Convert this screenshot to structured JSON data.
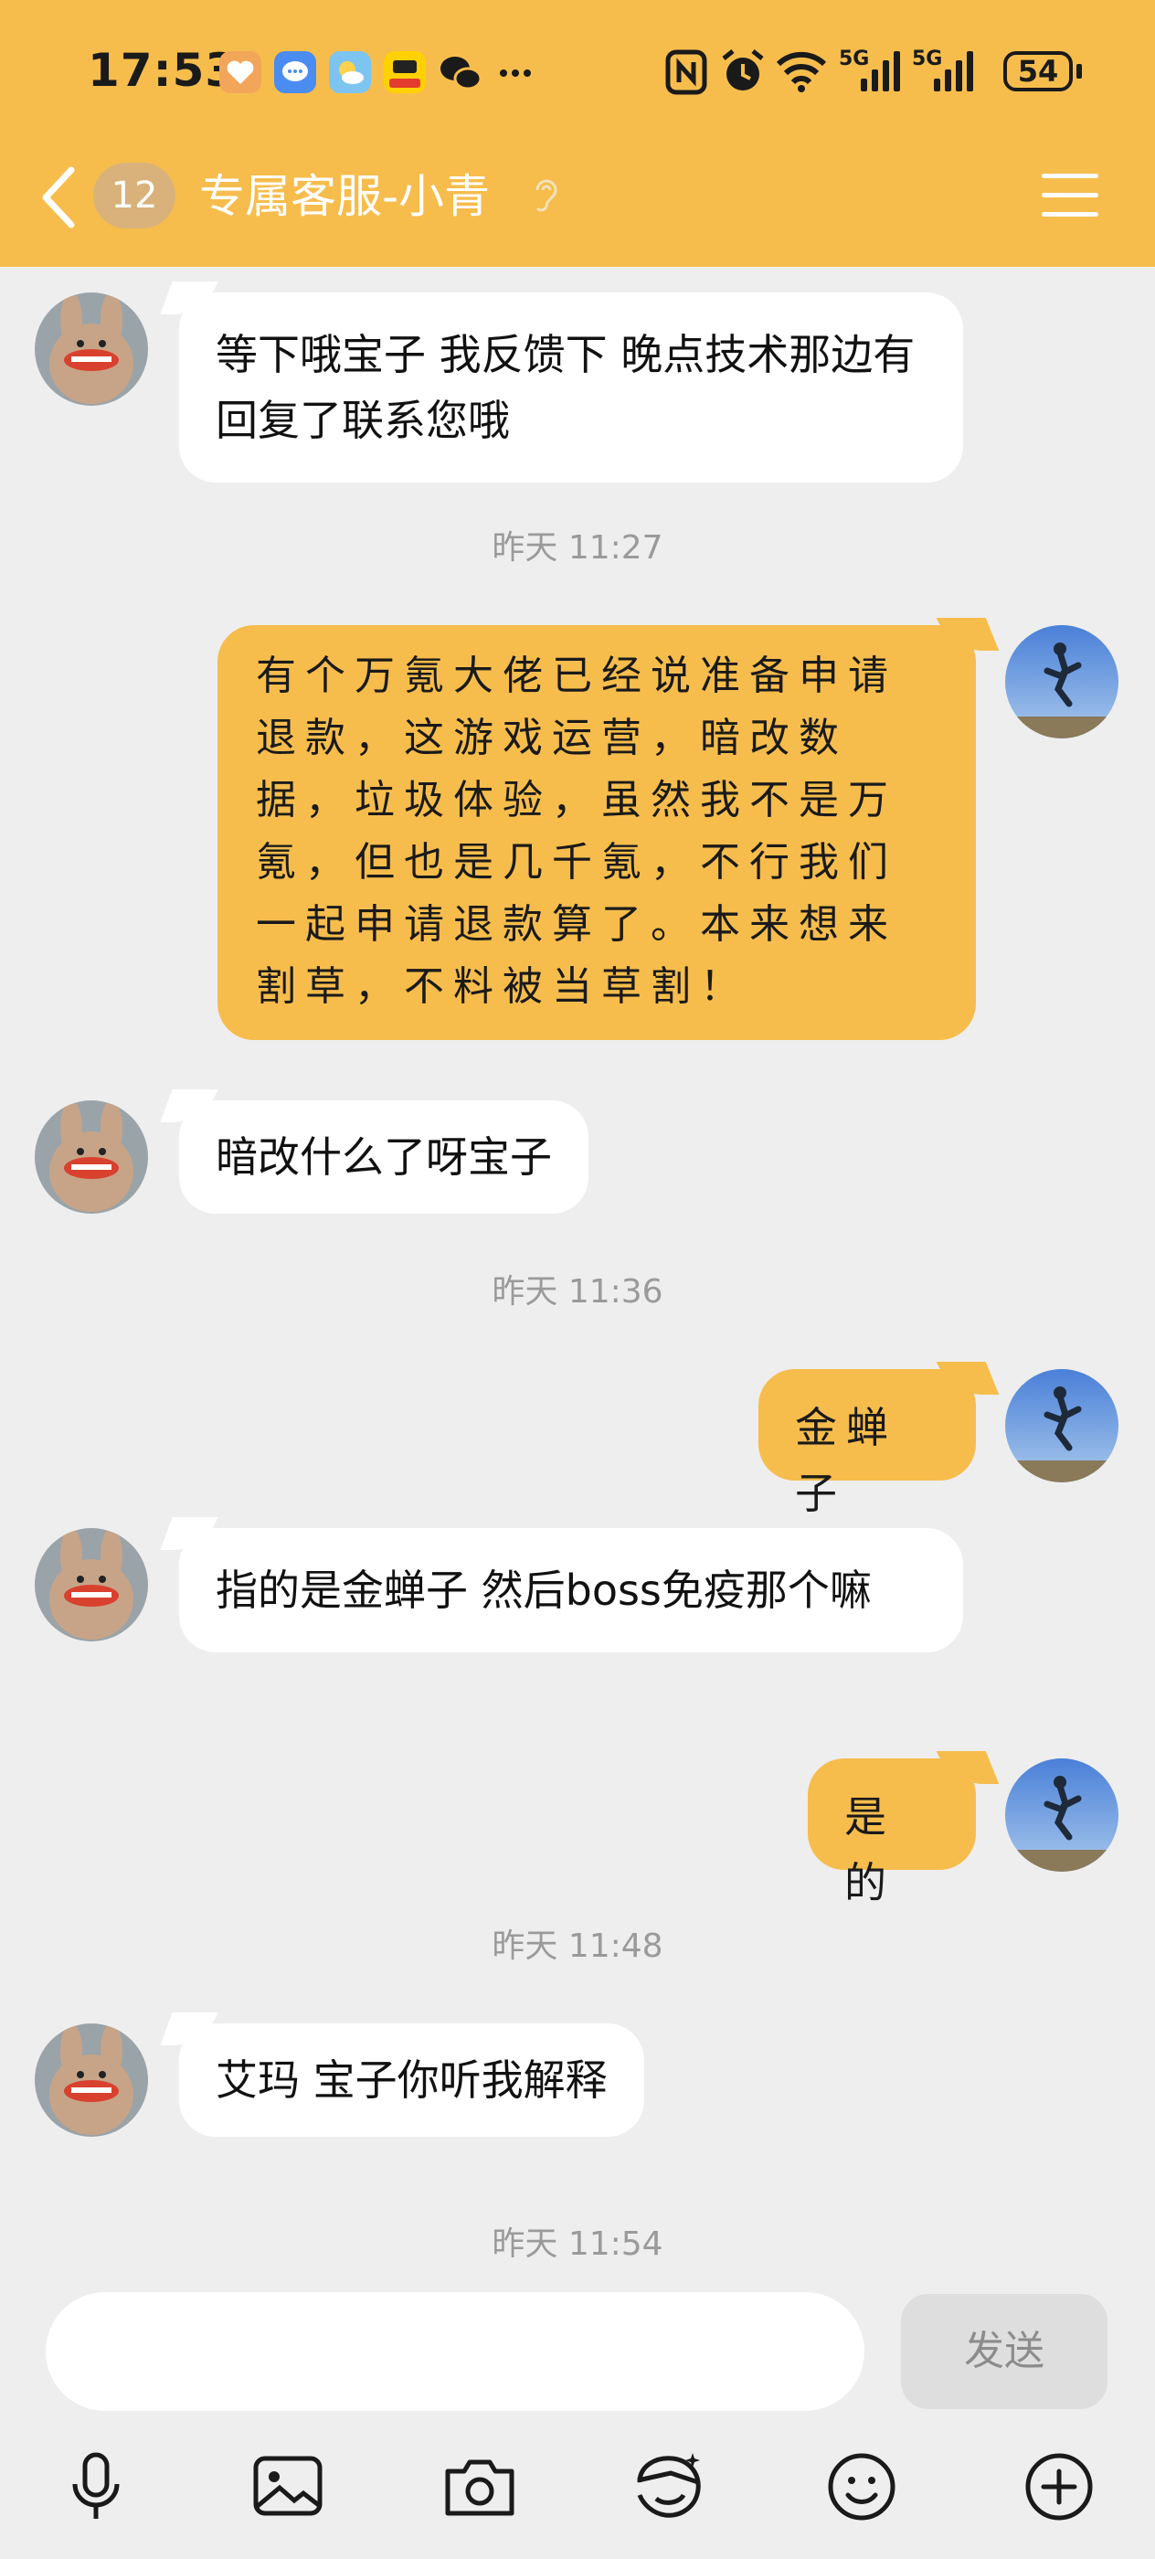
{
  "status_bar": {
    "time": "17:53",
    "signal1_label": "5G",
    "signal2_label": "5G",
    "battery": "54"
  },
  "header": {
    "unread_count": "12",
    "title": "专属客服-小青"
  },
  "messages": [
    {
      "side": "left",
      "text": "等下哦宝子 我反馈下 晚点技术那边有回复了联系您哦"
    },
    {
      "timestamp": "昨天 11:27"
    },
    {
      "side": "right",
      "text": "有个万氪大佬已经说准备申请退款，这游戏运营，暗改数据，垃圾体验，虽然我不是万氪，但也是几千氪，不行我们一起申请退款算了。本来想来割草，不料被当草割！"
    },
    {
      "side": "left",
      "text": "暗改什么了呀宝子"
    },
    {
      "timestamp": "昨天 11:36"
    },
    {
      "side": "right",
      "text": "金蝉子"
    },
    {
      "side": "left",
      "text": "指的是金蝉子 然后boss免疫那个嘛"
    },
    {
      "side": "right",
      "text": "是的"
    },
    {
      "timestamp": "昨天 11:48"
    },
    {
      "side": "left",
      "text": "艾玛 宝子你听我解释"
    },
    {
      "timestamp": "昨天 11:54"
    }
  ],
  "input": {
    "value": "",
    "send_label": "发送"
  },
  "toolbar": [
    "mic-icon",
    "image-icon",
    "camera-icon",
    "sticker-icon",
    "emoji-icon",
    "plus-icon"
  ],
  "colors": {
    "accent": "#f6bd4d",
    "background": "#eeeeee",
    "bubble_left": "#ffffff",
    "timestamp": "#9a9a9a"
  }
}
